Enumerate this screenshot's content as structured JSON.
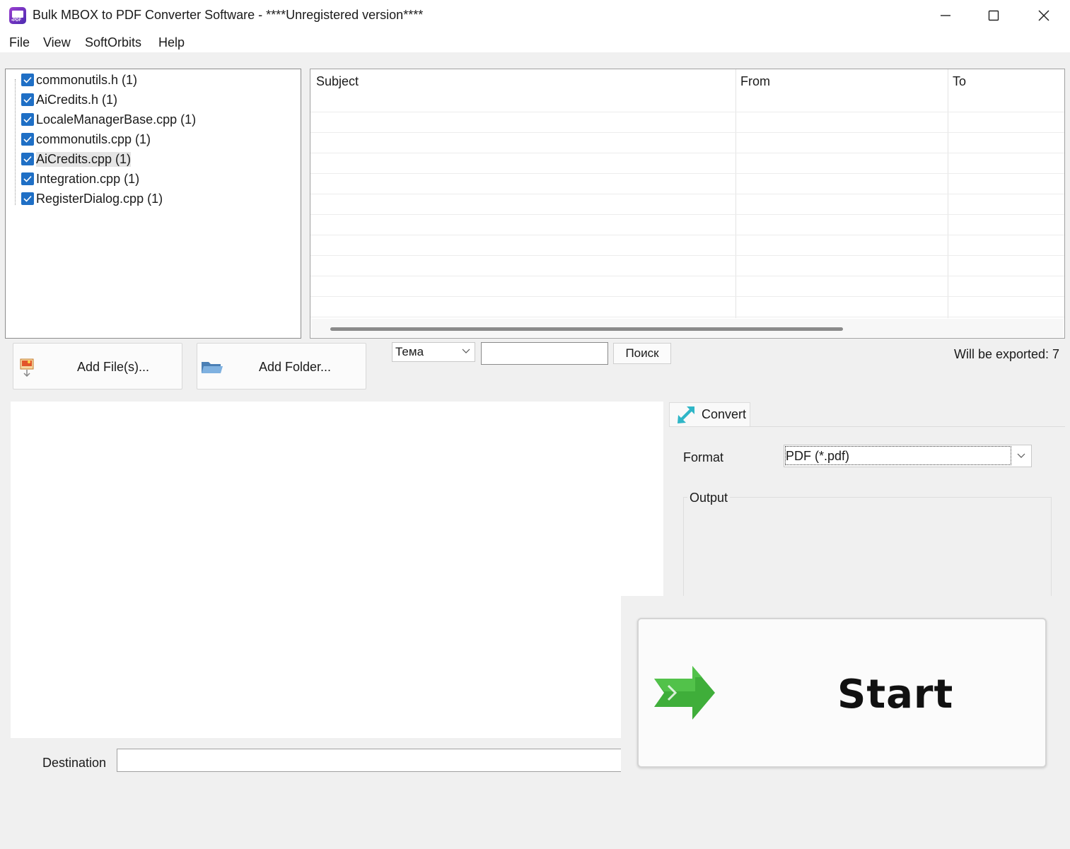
{
  "window": {
    "title": "Bulk MBOX to PDF Converter Software - ****Unregistered version****"
  },
  "menu": [
    {
      "label": "File"
    },
    {
      "label": "View"
    },
    {
      "label": "SoftOrbits"
    },
    {
      "label": "Help"
    }
  ],
  "tree": {
    "items": [
      {
        "label": "commonutils.h (1)",
        "checked": true
      },
      {
        "label": "AiCredits.h (1)",
        "checked": true
      },
      {
        "label": "LocaleManagerBase.cpp (1)",
        "checked": true
      },
      {
        "label": "commonutils.cpp (1)",
        "checked": true
      },
      {
        "label": "AiCredits.cpp (1)",
        "checked": true,
        "selected": true
      },
      {
        "label": "Integration.cpp (1)",
        "checked": true
      },
      {
        "label": "RegisterDialog.cpp (1)",
        "checked": true
      }
    ]
  },
  "grid": {
    "columns": [
      "Subject",
      "From",
      "To"
    ]
  },
  "toolbar": {
    "add_files_label": "Add File(s)...",
    "add_folder_label": "Add Folder...",
    "search_field_value": "Тема",
    "search_value": "",
    "search_button_label": "Поиск",
    "export_count_text": "Will be exported: 7"
  },
  "convert": {
    "tab_label": "Convert",
    "format_label": "Format",
    "format_value": "PDF (*.pdf)",
    "output_label": "Output"
  },
  "destination": {
    "label": "Destination",
    "value": ""
  },
  "start": {
    "label": "Start"
  },
  "colors": {
    "checkbox": "#1f6fc5",
    "start_arrow": "#3fae3a",
    "convert_icon": "#2fb6c7"
  }
}
